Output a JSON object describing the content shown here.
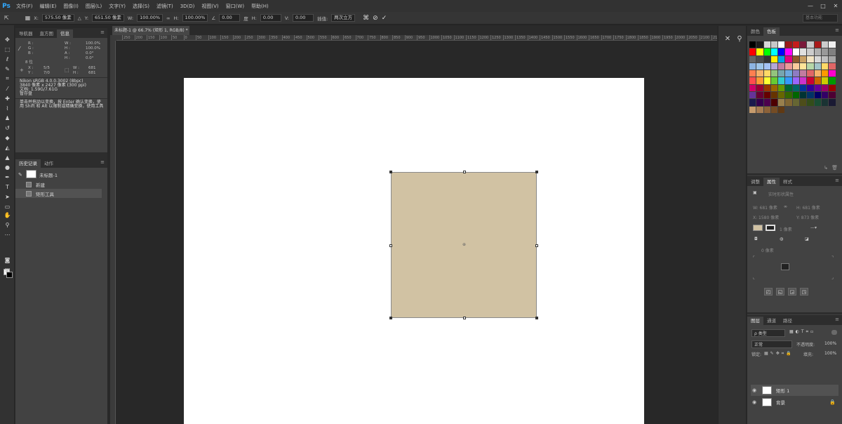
{
  "app": {
    "logo": "Ps",
    "accent": "#31a8ff"
  },
  "menu": [
    "文件(F)",
    "编辑(E)",
    "图像(I)",
    "图层(L)",
    "文字(Y)",
    "选择(S)",
    "滤镜(T)",
    "3D(D)",
    "视图(V)",
    "窗口(W)",
    "帮助(H)"
  ],
  "window_controls": [
    "—",
    "□",
    "✕"
  ],
  "options": {
    "x_label": "X:",
    "x_value": "575.50 像素",
    "y_label": "Y:",
    "y_value": "651.50 像素",
    "w_label": "W:",
    "w_value": "100.00%",
    "h_label": "H:",
    "h_value": "100.00%",
    "angle_value": "0.00",
    "angle_unit": "度",
    "hskew_label": "H:",
    "hskew_value": "0.00",
    "vskew_label": "V:",
    "vskew_value": "0.00",
    "interp_label": "插值:",
    "interp_value": "两次立方",
    "search_placeholder": "基本功能"
  },
  "left_panel": {
    "tabs": [
      "导航器",
      "直方图",
      "信息"
    ],
    "info": {
      "r": "R :",
      "g": "G :",
      "b": "B :",
      "bits": "8 位",
      "c": "C :",
      "m": "M :",
      "y": "Y :",
      "k": "K :",
      "w_label": "W :",
      "w_value": "100.0%",
      "h_label": "H :",
      "h_value": "100.0%",
      "a_label": "A :",
      "a_value": "0.0°",
      "hh_label": "H :",
      "hh_value": "0.0°",
      "x_label": "X :",
      "x_value": "5/5",
      "y_label": "Y :",
      "y_value": "7/0",
      "ww_label": "W :",
      "ww_value": "681",
      "hh2_label": "H :",
      "hh2_value": "681",
      "profile_1": "Nikon sRGB 4.0.0.3002 (8bpc)",
      "profile_2": "3840 像素 x 2427 像素 (300 ppi)",
      "profile_3": "文档: 1.59G/7.61G",
      "profile_4": "暂存盘",
      "hint": "单击并拖动以变换，按 Enter 确认变换，使用 Shift 和 Alt 以限制或精确变换，使用工具"
    },
    "history_tabs": [
      "历史记录",
      "动作"
    ],
    "history": [
      {
        "label": "未标题-1",
        "snapshot": true
      },
      {
        "label": "新建",
        "snapshot": false
      },
      {
        "label": "矩形工具",
        "snapshot": false
      }
    ]
  },
  "document": {
    "tab_label": "未标题-1 @ 66.7% (矩形 1, RGB/8) *",
    "ruler_ticks": [
      "250",
      "200",
      "150",
      "100",
      "50",
      "0",
      "50",
      "100",
      "150",
      "200",
      "250",
      "300",
      "350",
      "400",
      "450",
      "500",
      "550",
      "600",
      "650",
      "700",
      "750",
      "800",
      "850",
      "900",
      "950",
      "1000",
      "1050",
      "1100",
      "1150",
      "1200",
      "1250",
      "1300",
      "1350",
      "1400",
      "1450",
      "1500",
      "1550",
      "1600",
      "1650",
      "1700",
      "1750",
      "1800",
      "1850",
      "1900",
      "1950",
      "2000",
      "2050",
      "2100",
      "2150"
    ],
    "shape_color": "#d1c2a3",
    "canvas_color": "#ffffff"
  },
  "right_panel": {
    "swatch_tabs": [
      "颜色",
      "色板"
    ],
    "swatches": [
      "#000000",
      "#1c1c1c",
      "#d8d8d8",
      "#c8c8c8",
      "#ffffff",
      "#9a1a1a",
      "#c41d1d",
      "#7a1a3a",
      "#c8c8c8",
      "#aa1a1a",
      "#cccccc",
      "#f0f0f0",
      "#ff0000",
      "#ffff00",
      "#00ff00",
      "#00ffff",
      "#0000ff",
      "#ff00ff",
      "#ffffff",
      "#e0e0e0",
      "#cccccc",
      "#b0b0b0",
      "#999999",
      "#808080",
      "#666666",
      "#4d4d4d",
      "#333333",
      "#ffee00",
      "#00a0e9",
      "#e4007f",
      "#8f5a2c",
      "#c9a063",
      "#f3e5c4",
      "#d8d8d8",
      "#bfbfbf",
      "#a6a6a6",
      "#8db4e2",
      "#9fc5e8",
      "#a4c2f4",
      "#b4a7d6",
      "#c27ba0",
      "#ea9999",
      "#f9cb9c",
      "#ffe599",
      "#b6d7a8",
      "#a2c4c9",
      "#ffd966",
      "#e06666",
      "#ff7f50",
      "#f6b26b",
      "#ffd966",
      "#93c47d",
      "#76a5af",
      "#6fa8dc",
      "#8e7cc3",
      "#c27ba0",
      "#e06666",
      "#f6b26b",
      "#ff9900",
      "#ff00cc",
      "#ff4d4d",
      "#ff9933",
      "#ffff33",
      "#66cc33",
      "#33cccc",
      "#3399ff",
      "#9966ff",
      "#cc33cc",
      "#cc0033",
      "#cc6600",
      "#cccc00",
      "#009900",
      "#cc0066",
      "#990033",
      "#993300",
      "#996600",
      "#669900",
      "#006633",
      "#006666",
      "#003399",
      "#330099",
      "#660099",
      "#990066",
      "#990000",
      "#663399",
      "#660033",
      "#660000",
      "#663300",
      "#666600",
      "#336600",
      "#006600",
      "#003333",
      "#003366",
      "#000066",
      "#330066",
      "#4d0033",
      "#1a1a4d",
      "#33004d",
      "#4d004d",
      "#4d0000",
      "#99804d",
      "#806633",
      "#666633",
      "#4d4d1a",
      "#334d1a",
      "#1a4d33",
      "#1a3333",
      "#1a1a33",
      "#c69c6d",
      "#a67c52",
      "#8c6239",
      "#754c24",
      "#603913",
      "",
      "",
      "",
      "",
      "",
      "",
      ""
    ],
    "props_tabs": [
      "调整",
      "属性",
      "样式"
    ],
    "props_title": "实时形状属性",
    "props_w": "W: 681 像素",
    "props_h": "H: 681 像素",
    "props_x": "X: 1580 像素",
    "props_y": "Y: 873 像素",
    "props_stroke": "1 像素",
    "props_radius_label": "0 像素",
    "layers_tabs": [
      "图层",
      "通道",
      "路径"
    ],
    "layers_kind": "ρ 类型",
    "blend_mode": "正常",
    "opacity_label": "不透明度:",
    "opacity_value": "100%",
    "lock_label": "锁定:",
    "fill_label": "填充:",
    "fill_value": "100%",
    "layers": [
      {
        "name": "矩形 1",
        "selected": true,
        "locked": false
      },
      {
        "name": "背景",
        "selected": false,
        "locked": true
      }
    ]
  }
}
